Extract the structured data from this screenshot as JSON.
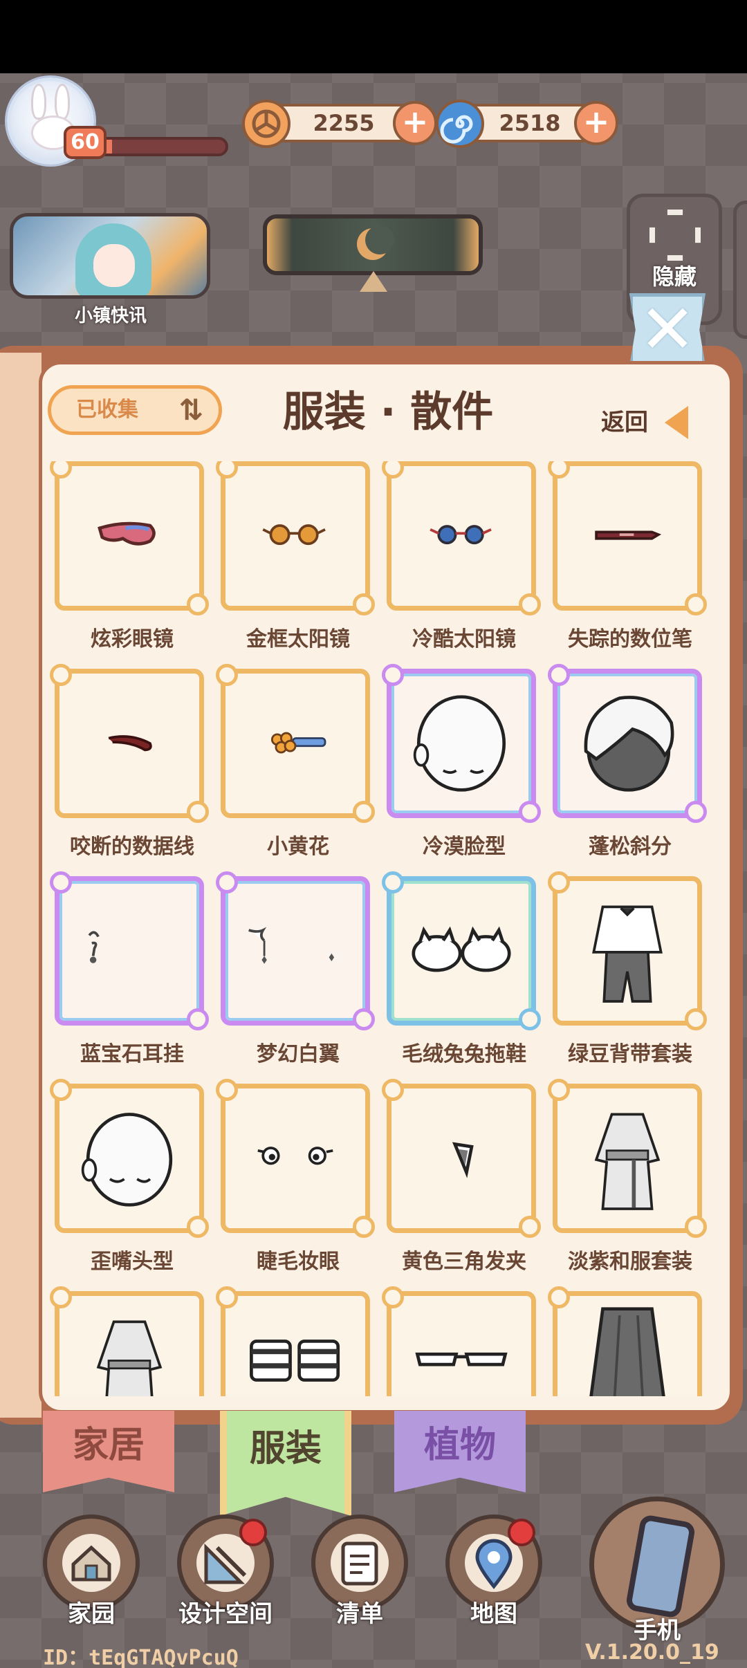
{
  "hud": {
    "level": "60",
    "xp_fraction": 0.1,
    "currency_gold": "2255",
    "currency_swirl": "2518",
    "news_label": "小镇快讯",
    "hide_label": "隐藏"
  },
  "panel": {
    "collected_label": "已收集",
    "title": "服装 · 散件",
    "back_label": "返回",
    "items": [
      {
        "name": "炫彩眼镜"
      },
      {
        "name": "金框太阳镜"
      },
      {
        "name": "冷酷太阳镜"
      },
      {
        "name": "失踪的数位笔"
      },
      {
        "name": "咬断的数据线"
      },
      {
        "name": "小黄花"
      },
      {
        "name": "冷漠脸型"
      },
      {
        "name": "蓬松斜分"
      },
      {
        "name": "蓝宝石耳挂"
      },
      {
        "name": "梦幻白翼"
      },
      {
        "name": "毛绒兔兔拖鞋"
      },
      {
        "name": "绿豆背带套装"
      },
      {
        "name": "歪嘴头型"
      },
      {
        "name": "睫毛妆眼"
      },
      {
        "name": "黄色三角发夹"
      },
      {
        "name": "淡紫和服套装"
      },
      {
        "name": ""
      },
      {
        "name": ""
      },
      {
        "name": ""
      },
      {
        "name": ""
      }
    ]
  },
  "tabs": {
    "home": "家居",
    "fashion": "服装",
    "plants": "植物"
  },
  "nav": {
    "home": "家园",
    "design": "设计空间",
    "list": "清单",
    "map": "地图",
    "phone": "手机"
  },
  "footer": {
    "user_id": "ID：tEqGTAQvPcuQ",
    "version": "V.1.20.0_19"
  },
  "colors": {
    "accent_orange": "#eeb865",
    "rare_border": "#c98bf0",
    "title_brown": "#5d3b2c"
  }
}
